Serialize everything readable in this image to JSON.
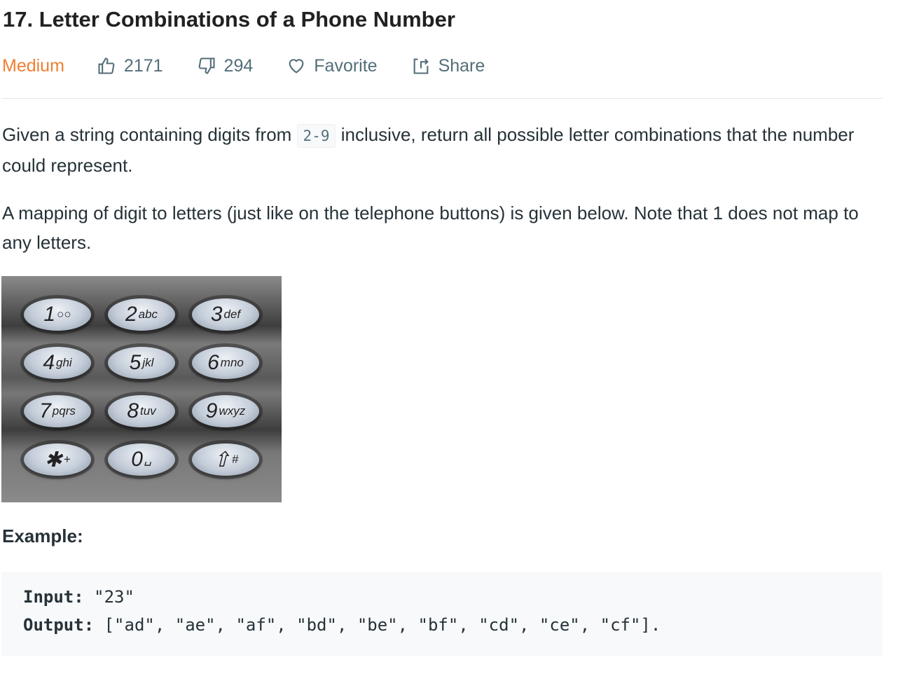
{
  "title": "17. Letter Combinations of a Phone Number",
  "meta": {
    "difficulty": "Medium",
    "difficulty_color": "#ef7f32",
    "likes": "2171",
    "dislikes": "294",
    "favorite": "Favorite",
    "share": "Share"
  },
  "description": {
    "p1_before": "Given a string containing digits from ",
    "p1_code": "2-9",
    "p1_after": " inclusive, return all possible letter combinations that the number could represent.",
    "p2": "A mapping of digit to letters (just like on the telephone buttons) is given below. Note that 1 does not map to any letters."
  },
  "keypad": [
    {
      "digit": "1",
      "letters": "○○"
    },
    {
      "digit": "2",
      "letters": "abc"
    },
    {
      "digit": "3",
      "letters": "def"
    },
    {
      "digit": "4",
      "letters": "ghi"
    },
    {
      "digit": "5",
      "letters": "jkl"
    },
    {
      "digit": "6",
      "letters": "mno"
    },
    {
      "digit": "7",
      "letters": "pqrs"
    },
    {
      "digit": "8",
      "letters": "tuv"
    },
    {
      "digit": "9",
      "letters": "wxyz"
    },
    {
      "digit": "✱",
      "letters": "+"
    },
    {
      "digit": "0",
      "letters": "␣"
    },
    {
      "digit": "⇧",
      "letters": "#"
    }
  ],
  "example": {
    "heading": "Example:",
    "input_label": "Input:",
    "input_value": " \"23\"",
    "output_label": "Output:",
    "output_value": " [\"ad\", \"ae\", \"af\", \"bd\", \"be\", \"bf\", \"cd\", \"ce\", \"cf\"]."
  }
}
